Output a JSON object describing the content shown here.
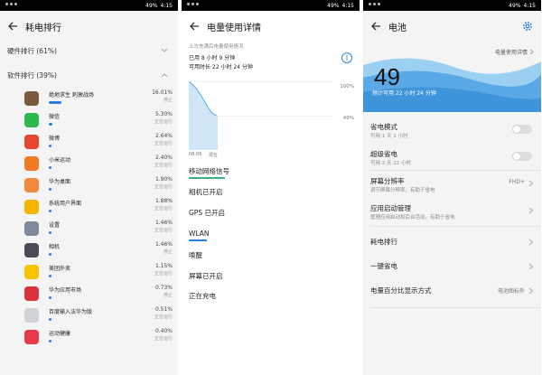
{
  "status": {
    "battery": "49%",
    "time": "4:15"
  },
  "left": {
    "title": "耗电排行",
    "hardware": "硬件排行 (61%)",
    "software": "软件排行 (39%)",
    "apps": [
      {
        "name": "绝地求生 刺激战场",
        "pct": "16.01%",
        "status": "停止",
        "fill": 0.16,
        "color": "#7a5a3a"
      },
      {
        "name": "微信",
        "pct": "5.30%",
        "status": "正在运行",
        "fill": 0.053,
        "color": "#2db94d"
      },
      {
        "name": "微博",
        "pct": "2.64%",
        "status": "正在运行",
        "fill": 0.026,
        "color": "#e6452f"
      },
      {
        "name": "小米运动",
        "pct": "2.40%",
        "status": "正在运行",
        "fill": 0.024,
        "color": "#f07a25"
      },
      {
        "name": "华为桌面",
        "pct": "1.90%",
        "status": "正在运行",
        "fill": 0.019,
        "color": "#f08a3a"
      },
      {
        "name": "系统用户界面",
        "pct": "1.88%",
        "status": "正在运行",
        "fill": 0.019,
        "color": "#f4b400"
      },
      {
        "name": "设置",
        "pct": "1.46%",
        "status": "正在运行",
        "fill": 0.015,
        "color": "#7d8a99"
      },
      {
        "name": "相机",
        "pct": "1.46%",
        "status": "停止",
        "fill": 0.015,
        "color": "#4a4a5a"
      },
      {
        "name": "美团外卖",
        "pct": "1.15%",
        "status": "正在运行",
        "fill": 0.012,
        "color": "#f8c300"
      },
      {
        "name": "华为应用市场",
        "pct": "0.73%",
        "status": "停止",
        "fill": 0.007,
        "color": "#d9323a"
      },
      {
        "name": "百度输入法华为版",
        "pct": "0.51%",
        "status": "正在运行",
        "fill": 0.005,
        "color": "#cfd3d8"
      },
      {
        "name": "运动健康",
        "pct": "0.40%",
        "status": "正在运行",
        "fill": 0.004,
        "color": "#e8394a"
      }
    ]
  },
  "mid": {
    "title": "电量使用详情",
    "since": "上次充满后电量使用情况",
    "used": "已用 8 小时 9 分钟",
    "remain": "可用时长 22 小时 24 分钟",
    "pct_top": "100%",
    "pct_mid": "49%",
    "t_start": "08:06",
    "t_now": "现在",
    "events": [
      "移动网络信号",
      "相机已开启",
      "GPS 已开启",
      "WLAN",
      "唤醒",
      "屏幕已开启",
      "正在充电"
    ],
    "battery_curve": [
      100,
      97,
      94,
      90,
      85,
      80,
      74,
      68,
      62,
      57,
      53,
      51,
      49
    ]
  },
  "right": {
    "title": "电池",
    "detail_link": "电量使用详情",
    "level": "49",
    "estimate": "预计可用 22 小时 24 分钟",
    "rows": [
      {
        "title": "省电模式",
        "sub": "可用 1 天 1 小时",
        "type": "toggle"
      },
      {
        "title": "超级省电",
        "sub": "可用 2 天 22 小时",
        "type": "toggle"
      },
      {
        "title": "屏幕分辨率",
        "sub": "调节屏幕分辨率，有助于省电",
        "value": "FHD+",
        "type": "link"
      },
      {
        "title": "应用启动管理",
        "sub": "管理应用启动和后台活动，有助于省电",
        "type": "link"
      },
      {
        "title": "耗电排行",
        "sub": "",
        "type": "link"
      },
      {
        "title": "一键省电",
        "sub": "",
        "type": "link"
      },
      {
        "title": "电量百分比显示方式",
        "sub": "",
        "value": "电池图标外",
        "type": "link"
      }
    ]
  },
  "colors": {
    "accent": "#2a7de1",
    "green": "#36b37e",
    "wave": "#5aa9e6"
  },
  "icons": {
    "back": "arrow-left-icon",
    "gear": "gear-icon",
    "info": "info-icon",
    "chevron": "chevron-right-icon"
  }
}
